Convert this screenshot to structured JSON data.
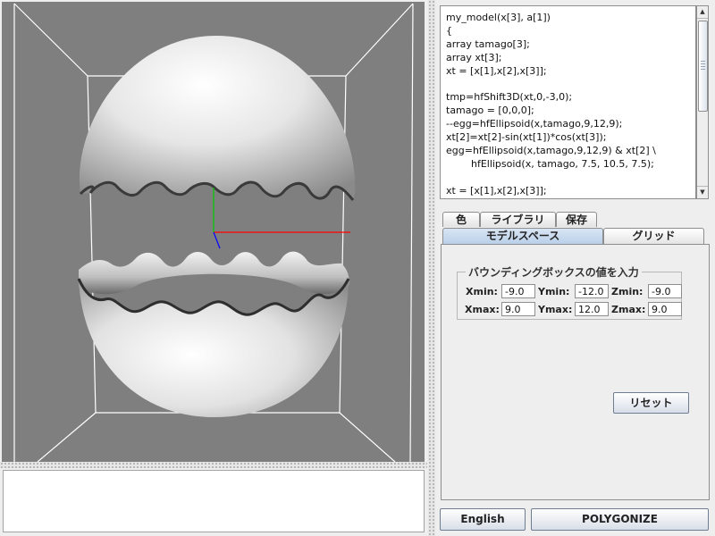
{
  "code_editor": {
    "lines": [
      "my_model(x[3], a[1])",
      "{",
      "array tamago[3];",
      "array xt[3];",
      "xt = [x[1],x[2],x[3]];",
      "",
      "tmp=hfShift3D(xt,0,-3,0);",
      "tamago = [0,0,0];",
      "--egg=hfEllipsoid(x,tamago,9,12,9);",
      "xt[2]=xt[2]-sin(xt[1])*cos(xt[3]);",
      "egg=hfEllipsoid(x,tamago,9,12,9) & xt[2] \\",
      "        hfEllipsoid(x, tamago, 7.5, 10.5, 7.5);",
      "",
      "xt = [x[1],x[2],x[3]];"
    ]
  },
  "tabs_top": {
    "color": "色",
    "library": "ライブラリ",
    "save": "保存"
  },
  "tabs_bottom": {
    "model_space": "モデルスペース",
    "grid": "グリッド"
  },
  "bounding_box": {
    "title": "バウンディングボックスの値を入力",
    "xmin_label": "Xmin:",
    "ymin_label": "Ymin:",
    "zmin_label": "Zmin:",
    "xmax_label": "Xmax:",
    "ymax_label": "Ymax:",
    "zmax_label": "Zmax:",
    "xmin": "-9.0",
    "ymin": "-12.0",
    "zmin": "-9.0",
    "xmax": "9.0",
    "ymax": "12.0",
    "zmax": "9.0"
  },
  "buttons": {
    "reset": "リセット",
    "english": "English",
    "polygonize": "POLYGONIZE"
  },
  "icons": {
    "scroll_up": "up-arrow-icon",
    "scroll_down": "down-arrow-icon"
  },
  "colors": {
    "viewport_bg": "#7f7f7f",
    "axis_x": "#ff0000",
    "axis_y": "#00cc00",
    "axis_z": "#0000ff",
    "selected_tab": "#b8cfe9"
  },
  "log": {
    "text": ""
  }
}
